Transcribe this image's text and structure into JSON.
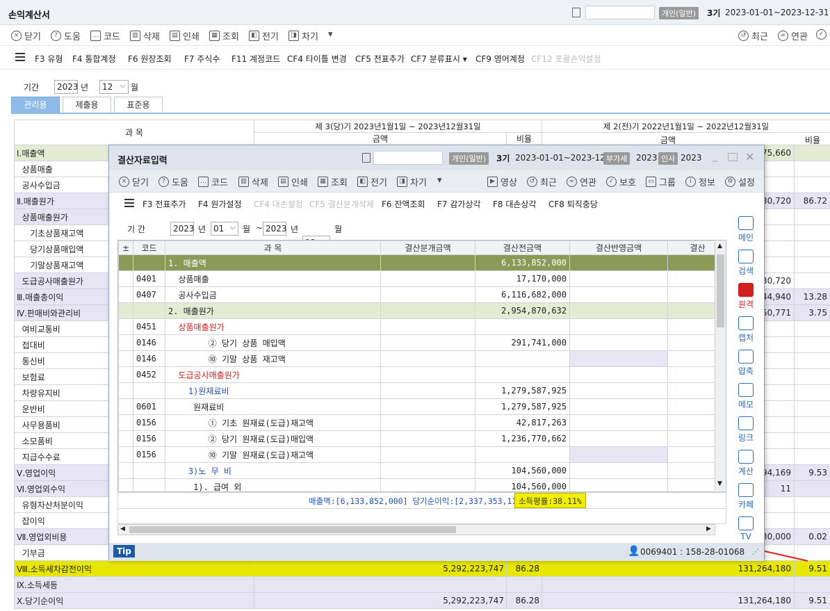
{
  "window": {
    "title": "손익계산서",
    "badge": "개인(일반)",
    "period_label": "3기",
    "period_range": "2023-01-01~2023-12-31"
  },
  "toolbar": {
    "items": [
      "닫기",
      "도움",
      "코드",
      "삭제",
      "인쇄",
      "조회",
      "전기",
      "차기"
    ],
    "more": "▾",
    "right": [
      "최근",
      "연관"
    ]
  },
  "fkeys": [
    {
      "k": "F3 유형"
    },
    {
      "k": "F4 통합계정"
    },
    {
      "k": "F6 원장조회"
    },
    {
      "k": "F7 주식수"
    },
    {
      "k": "F11 계정코드"
    },
    {
      "k": "CF4 타이틀 변경"
    },
    {
      "k": "CF5 전표추가"
    },
    {
      "k": "CF7 분류표시 ▾"
    },
    {
      "k": "CF9 영어계정"
    },
    {
      "k": "CF12 포괄손익설정",
      "disabled": true
    }
  ],
  "period": {
    "label": "기간",
    "year": "2023",
    "year_unit": "년",
    "month": "12",
    "month_unit": "월"
  },
  "tabs": [
    "관리용",
    "제출용",
    "표준용"
  ],
  "grid": {
    "col_account": "과      목",
    "cur_header": "제 3(당)기  2023년1월1일  ~  2023년12월31일",
    "prev_header": "제 2(전)기  2022년1월1일  ~  2022년12월31일",
    "amount": "금액",
    "ratio": "비율",
    "rows": [
      {
        "name": "Ⅰ.매출액",
        "cur": "",
        "cr": "",
        "prev": "475,660",
        "pr": "",
        "cls": "rowG"
      },
      {
        "name": "  상품매출",
        "cur": "",
        "cr": "",
        "prev": "",
        "pr": ""
      },
      {
        "name": "  공사수입금",
        "cur": "",
        "cr": "",
        "prev": "",
        "pr": ""
      },
      {
        "name": "Ⅱ.매출원가",
        "cur": "",
        "cr": "",
        "prev": "130,720",
        "pr": "86.72",
        "cls": "rowP"
      },
      {
        "name": "  상품매출원가",
        "cur": "",
        "cr": "",
        "prev": "",
        "pr": "",
        "cls": "rowP2"
      },
      {
        "name": "     기초상품재고액",
        "cur": "",
        "cr": "",
        "prev": "",
        "pr": ""
      },
      {
        "name": "     당기상품매입액",
        "cur": "",
        "cr": "",
        "prev": "",
        "pr": ""
      },
      {
        "name": "     기말상품재고액",
        "cur": "",
        "cr": "",
        "prev": "",
        "pr": ""
      },
      {
        "name": "  도급공사매출원가",
        "cur": "",
        "cr": "",
        "prev": "130,720",
        "pr": "",
        "cls": "rowP2"
      },
      {
        "name": "Ⅲ.매출총이익",
        "cur": "",
        "cr": "",
        "prev": "344,940",
        "pr": "13.28",
        "cls": "rowP"
      },
      {
        "name": "Ⅳ.판매비와관리비",
        "cur": "",
        "cr": "",
        "prev": "750,771",
        "pr": "3.75",
        "cls": "rowP"
      },
      {
        "name": "  여비교통비",
        "cur": "",
        "cr": "",
        "prev": "",
        "pr": ""
      },
      {
        "name": "  접대비",
        "cur": "",
        "cr": "",
        "prev": "",
        "pr": ""
      },
      {
        "name": "  통신비",
        "cur": "",
        "cr": "",
        "prev": "",
        "pr": ""
      },
      {
        "name": "  보험료",
        "cur": "",
        "cr": "",
        "prev": "",
        "pr": ""
      },
      {
        "name": "  차량유지비",
        "cur": "",
        "cr": "",
        "prev": "",
        "pr": ""
      },
      {
        "name": "  운반비",
        "cur": "",
        "cr": "",
        "prev": "",
        "pr": ""
      },
      {
        "name": "  사무용품비",
        "cur": "",
        "cr": "",
        "prev": "",
        "pr": ""
      },
      {
        "name": "  소모품비",
        "cur": "",
        "cr": "",
        "prev": "",
        "pr": ""
      },
      {
        "name": "  지급수수료",
        "cur": "",
        "cr": "",
        "prev": "",
        "pr": ""
      },
      {
        "name": "Ⅴ.영업이익",
        "cur": "",
        "cr": "",
        "prev": "594,169",
        "pr": "9.53",
        "cls": "rowP"
      },
      {
        "name": "Ⅵ.영업외수익",
        "cur": "",
        "cr": "",
        "prev": "11",
        "pr": "",
        "cls": "rowP"
      },
      {
        "name": "  유형자산처분이익",
        "cur": "",
        "cr": "",
        "prev": "",
        "pr": ""
      },
      {
        "name": "  잡이익",
        "cur": "",
        "cr": "",
        "prev": "",
        "pr": ""
      },
      {
        "name": "Ⅶ.영업외비용",
        "cur": "",
        "cr": "",
        "prev": "330,000",
        "pr": "0.02",
        "cls": "rowP"
      },
      {
        "name": "  기부금",
        "cur": "",
        "cr": "",
        "prev": "",
        "pr": ""
      },
      {
        "name": "Ⅷ.소득세차감전이익",
        "cur": "5,292,223,747",
        "cr": "86.28",
        "prev": "131,264,180",
        "pr": "9.51",
        "cls": "rowY"
      },
      {
        "name": "Ⅸ.소득세등",
        "cur": "",
        "cr": "",
        "prev": "",
        "pr": "",
        "cls": "rowP"
      },
      {
        "name": "Ⅹ.당기순이익",
        "cur": "5,292,223,747",
        "cr": "86.28",
        "prev": "131,264,180",
        "pr": "9.51",
        "cls": "rowP"
      }
    ]
  },
  "modal": {
    "title": "결산자료입력",
    "badge": "개인(일반)",
    "period_label": "3기",
    "period_range": "2023-01-01~2023-12-31",
    "tax_badge": "부가세",
    "tax_year": "2023",
    "hr_badge": "인사",
    "hr_year": "2023",
    "toolbar": [
      "닫기",
      "도움",
      "코드",
      "삭제",
      "인쇄",
      "조회",
      "전기",
      "차기"
    ],
    "more": "▾",
    "toolbar_right": [
      "영상",
      "최근",
      "연관",
      "보호",
      "그룹",
      "정보",
      "설정"
    ],
    "fkeys": [
      {
        "k": "F3 전표추가"
      },
      {
        "k": "F4 원가설정"
      },
      {
        "k": "CF4 대손설정",
        "disabled": true
      },
      {
        "k": "CF5 결산분개삭제",
        "disabled": true
      },
      {
        "k": "F6 잔액조회"
      },
      {
        "k": "F7 감가상각"
      },
      {
        "k": "F8 대손상각"
      },
      {
        "k": "CF8 퇴직충당"
      }
    ],
    "period": {
      "label": "기    간",
      "y1": "2023",
      "u1": "년",
      "m1": "01",
      "mu1": "월",
      "tilde": "~",
      "y2": "2023",
      "u2": "년",
      "m2": "12",
      "mu2": "월"
    },
    "cols": [
      "±",
      "코드",
      "과          목",
      "결산분개금액",
      "결산전금액",
      "결산반영금액",
      "결산"
    ],
    "rows": [
      {
        "code": "",
        "name": "1. 매출액",
        "pre": "6,133,852,000",
        "cls": "dark"
      },
      {
        "code": "0401",
        "name": "  상품매출",
        "pre": "17,170,000"
      },
      {
        "code": "0407",
        "name": "  공사수입금",
        "pre": "6,116,682,000"
      },
      {
        "code": "",
        "name": "2. 매출원가",
        "pre": "2,954,870,632",
        "cls": "lg"
      },
      {
        "code": "0451",
        "name": "  상품매출원가",
        "pre": "",
        "color": "red"
      },
      {
        "code": "0146",
        "name": "        ② 당기 상품 매입액",
        "pre": "291,741,000"
      },
      {
        "code": "0146",
        "name": "        ⑩ 기말 상품 재고액",
        "pre": "",
        "shade": true
      },
      {
        "code": "0452",
        "name": "  도급공사매출원가",
        "pre": "",
        "color": "red"
      },
      {
        "code": "",
        "name": "    1)원재료비",
        "pre": "1,279,587,925",
        "color": "blue"
      },
      {
        "code": "0601",
        "name": "     원재료비",
        "pre": "1,279,587,925"
      },
      {
        "code": "0156",
        "name": "        ① 기초 원재료(도급)재고액",
        "pre": "42,817,263"
      },
      {
        "code": "0156",
        "name": "        ② 당기 원재료(도급)매입액",
        "pre": "1,236,770,662"
      },
      {
        "code": "0156",
        "name": "        ⑩ 기말 원재료(도급)재고액",
        "pre": "",
        "shade": true
      },
      {
        "code": "",
        "name": "    3)노 무 비",
        "pre": "104,560,000",
        "color": "blue"
      },
      {
        "code": "",
        "name": "     1). 급여 외",
        "pre": "104,560,000"
      }
    ],
    "summary": "매출액:[6,133,852,000] 당기순이익:[2,337,353,115]",
    "income_rate": "소득평률:38.11%",
    "side": [
      "메인",
      "검색",
      "원격",
      "캡처",
      "압축",
      "메모",
      "링크",
      "계산",
      "카페",
      "TV"
    ],
    "tip": "Tip",
    "user": "0069401 : 158-28-01068"
  }
}
